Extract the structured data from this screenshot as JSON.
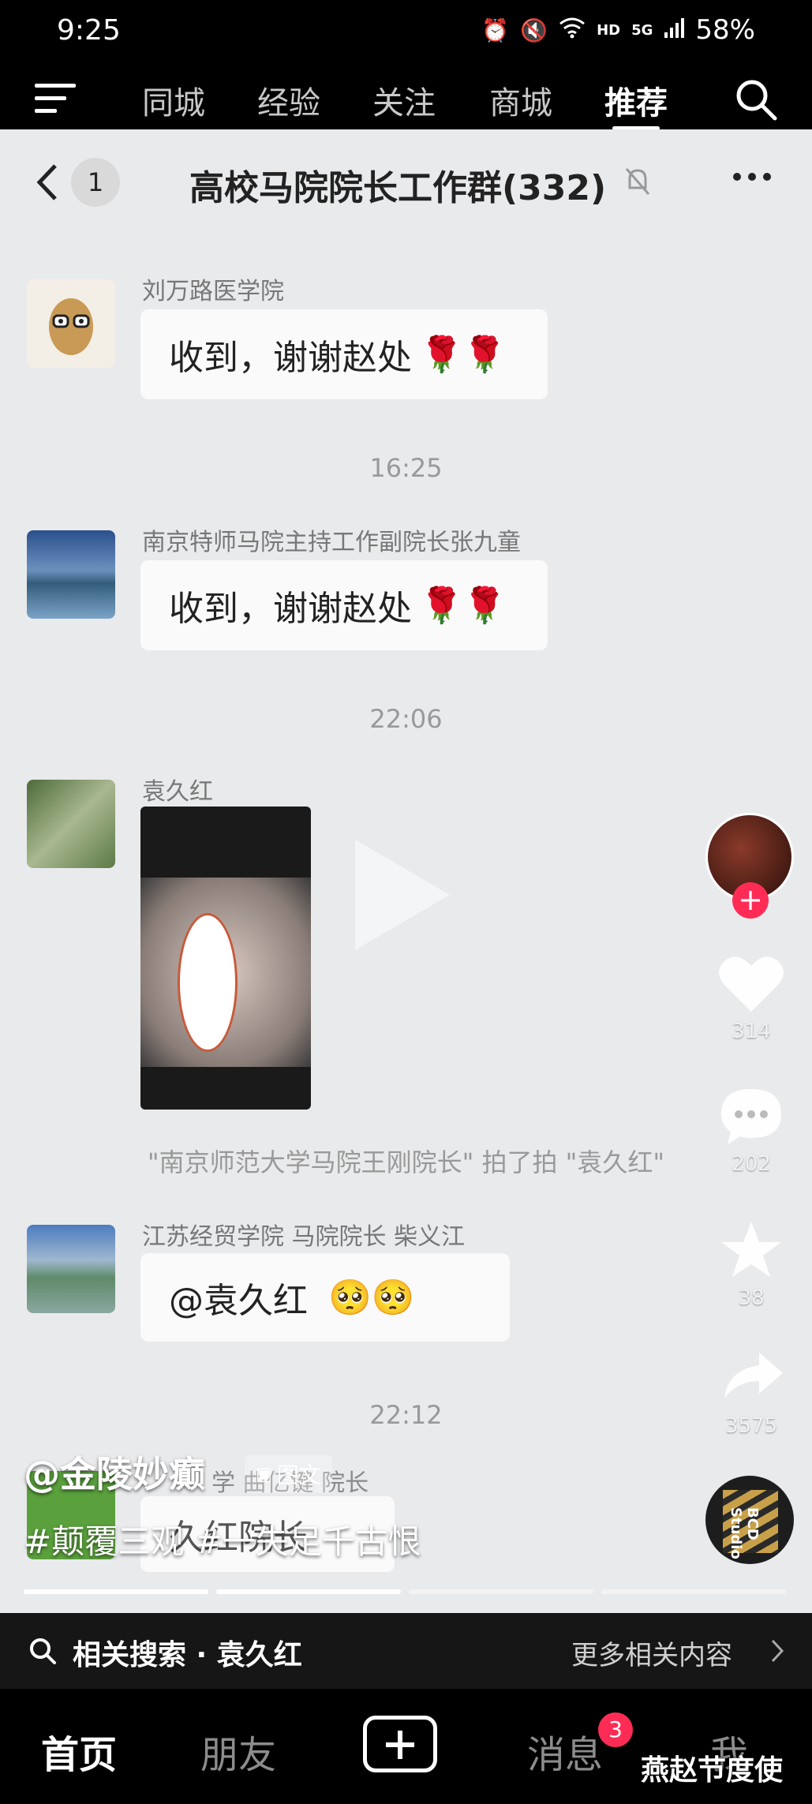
{
  "status": {
    "time": "9:25",
    "network_hd": "HD",
    "network_5g": "5G",
    "battery": "58%"
  },
  "topnav": {
    "tabs": [
      "同城",
      "经验",
      "关注",
      "商城",
      "推荐"
    ],
    "active_tab": "推荐"
  },
  "chat": {
    "unread_count": "1",
    "title": "高校马院院长工作群(332)",
    "messages": [
      {
        "sender": "刘万路医学院",
        "text": "收到，谢谢赵处"
      },
      {
        "time": "16:25"
      },
      {
        "sender": "南京特师马院主持工作副院长张九童",
        "text": "收到，谢谢赵处"
      },
      {
        "time": "22:06"
      },
      {
        "sender": "袁久红"
      },
      {
        "system": "\"南京师范大学马院王刚院长\" 拍了拍 \"袁久红\""
      },
      {
        "sender": "江苏经贸学院 马院院长  柴义江",
        "text": "@袁久红"
      },
      {
        "time": "22:12"
      },
      {
        "sender_partial": "学 曲亿键 院长",
        "text_partial": "久红院长"
      }
    ]
  },
  "post": {
    "author": "@金陵妙癫",
    "tag": "图文",
    "hashtags": "#颠覆三观 #一失足千古恨",
    "progress_segments": [
      1,
      1,
      0,
      0
    ]
  },
  "actions": {
    "likes": "314",
    "comments": "202",
    "favorites": "38",
    "shares": "3575",
    "music_label": "BCD Studio"
  },
  "related": {
    "prefix": "相关搜索 · ",
    "keyword": "袁久红",
    "more": "更多相关内容"
  },
  "bottomnav": {
    "home": "首页",
    "friends": "朋友",
    "messages": "消息",
    "messages_badge": "3",
    "me": "我"
  },
  "watermark": "燕赵节度使",
  "colors": {
    "accent": "#fe2c55",
    "chat_bg": "#e9eaec",
    "bubble": "#fafafa"
  }
}
